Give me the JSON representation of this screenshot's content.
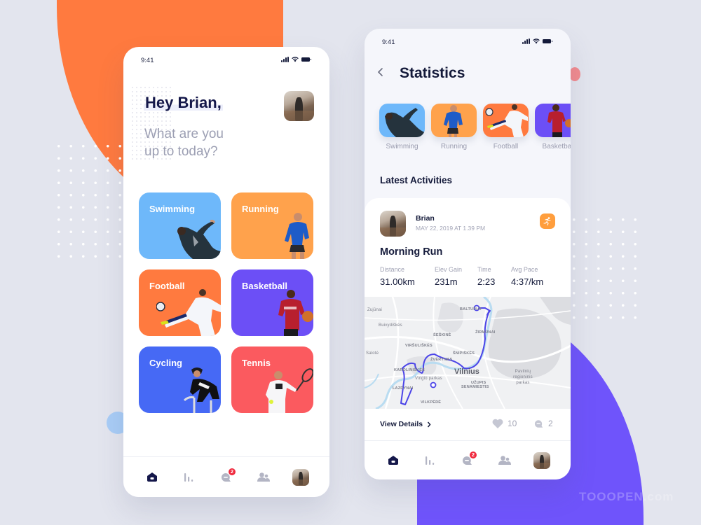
{
  "colors": {
    "background": "#e3e5ee",
    "accent_orange": "#ff7a3f",
    "accent_purple": "#6f54fb",
    "text_primary": "#141a3a",
    "text_muted": "#9c9fb3",
    "badge_red": "#f0293d"
  },
  "home": {
    "status_time": "9:41",
    "greeting": "Hey Brian,",
    "subtitle": "What are you up to today?",
    "tiles": [
      {
        "label": "Swimming",
        "color": "#6eb8fa",
        "icon": "swimmer-icon"
      },
      {
        "label": "Running",
        "color": "#ffa24c",
        "icon": "runner-icon"
      },
      {
        "label": "Football",
        "color": "#ff7a3f",
        "icon": "football-player-icon"
      },
      {
        "label": "Basketball",
        "color": "#6c4ff6",
        "icon": "basketball-player-icon"
      },
      {
        "label": "Cycling",
        "color": "#4669f5",
        "icon": "cyclist-icon"
      },
      {
        "label": "Tennis",
        "color": "#fb5a5f",
        "icon": "tennis-player-icon"
      }
    ],
    "tabbar": {
      "items": [
        "home-icon",
        "stats-icon",
        "chat-icon",
        "people-icon",
        "profile-avatar"
      ],
      "active": "home-icon",
      "chat_badge": "2"
    }
  },
  "stats": {
    "status_time": "9:41",
    "title": "Statistics",
    "categories": [
      {
        "label": "Swimming",
        "color": "#6eb8fa"
      },
      {
        "label": "Running",
        "color": "#ffa24c"
      },
      {
        "label": "Football",
        "color": "#ff7a3f"
      },
      {
        "label": "Basketbal",
        "color": "#6c4ff6"
      }
    ],
    "section_title": "Latest Activities",
    "activity": {
      "user": "Brian",
      "date": "MAY 22, 2019 AT 1.39 PM",
      "type_icon": "running-icon",
      "title": "Morning Run",
      "metrics": [
        {
          "label": "Distance",
          "value": "31.00km"
        },
        {
          "label": "Elev Gain",
          "value": "231m"
        },
        {
          "label": "Time",
          "value": "2:23"
        },
        {
          "label": "Avg Pace",
          "value": "4:37/km"
        }
      ],
      "map": {
        "city": "Vilnius",
        "places": [
          "Zujūnai",
          "Buivydiškės",
          "Baltupiai",
          "Šeškinė",
          "Žirmūnai",
          "Viršuliškės",
          "Šnipiškės",
          "Žvėrynas",
          "Karoliniškės",
          "Vingio parkas",
          "Lazdynai",
          "Užupis",
          "Senamiestis",
          "Vilkpėdė",
          "Pavilnių regioninis parkas",
          "Salotė"
        ],
        "route_color": "#4c45e8"
      },
      "view_details": "View Details",
      "likes": "10",
      "comments": "2"
    },
    "tabbar": {
      "chat_badge": "2"
    }
  },
  "watermark": "TOOOPEN.com"
}
